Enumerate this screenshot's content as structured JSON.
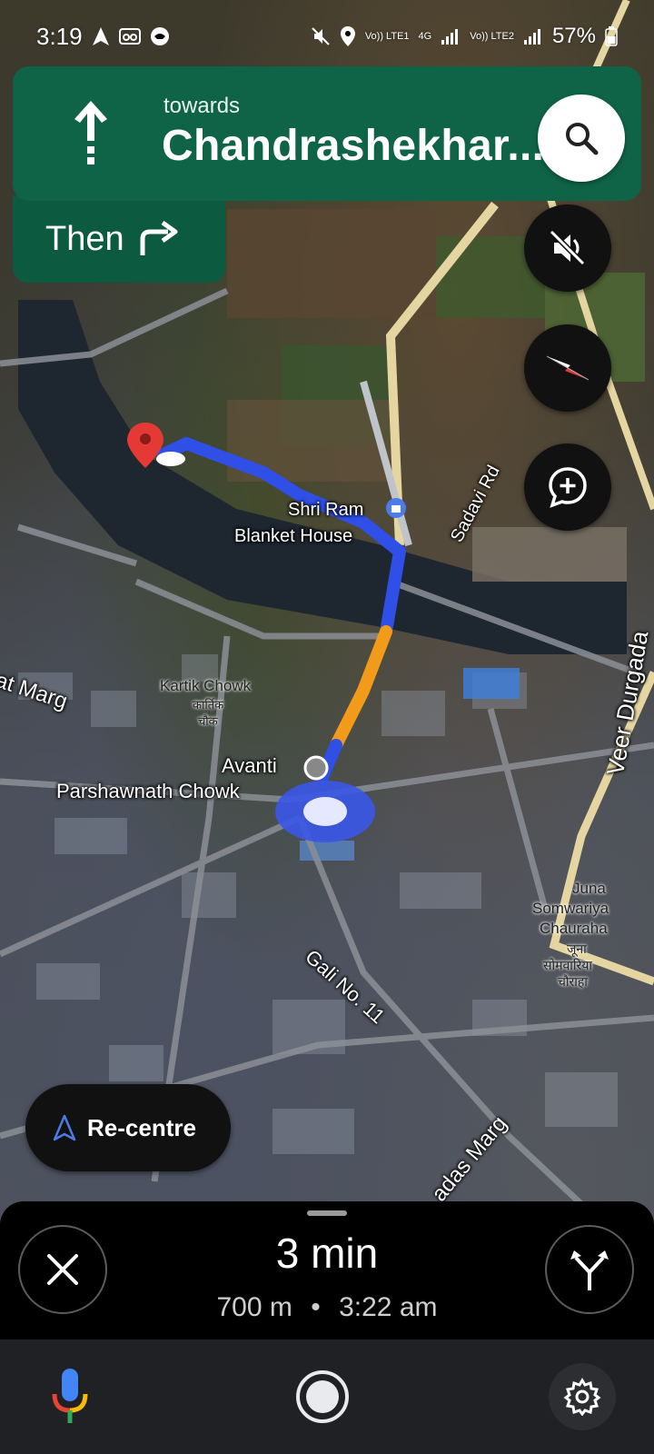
{
  "status_bar": {
    "time": "3:19",
    "sim1": "Vo)) LTE1",
    "network": "4G",
    "sim2": "Vo)) LTE2",
    "battery": "57%"
  },
  "navigation": {
    "towards_label": "towards",
    "street": "Chandrashekhar...",
    "then_label": "Then",
    "direction": "straight",
    "next_direction": "right"
  },
  "map_labels": {
    "poi_shop": "Shri Ram",
    "poi_shop_line2": "Blanket House",
    "road_sadavi": "Sadavi Rd",
    "road_veer": "Veer Durgada",
    "road_marg_left": "at Marg",
    "chowk_kartik": "Kartik Chowk",
    "chowk_kartik_hi": "कार्तिक",
    "chowk_kartik_hi2": "चौक",
    "place_avanti": "Avanti",
    "place_parshawnath": "Parshawnath Chowk",
    "place_juna": "Juna",
    "place_somwariya": "Somwariya",
    "place_chauraha": "Chauraha",
    "place_hi1": "जूना",
    "place_hi2": "सोमवारिया",
    "place_hi3": "चौराहा",
    "road_gali": "Gali No. 11",
    "road_das": "adas Marg"
  },
  "buttons": {
    "recentre_label": "Re-centre"
  },
  "trip": {
    "duration": "3 min",
    "distance": "700 m",
    "separator": "•",
    "eta": "3:22 am"
  },
  "colors": {
    "nav_green": "#0f6447",
    "route_blue": "#2f4fe6",
    "traffic_orange": "#f29a1a",
    "destination_red": "#e53935"
  },
  "icons": {
    "search": "search-icon",
    "mute": "volume-mute-icon",
    "compass": "compass-icon",
    "report": "add-report-icon",
    "recentre": "navigation-arrow-icon",
    "close": "close-icon",
    "alt_routes": "alternate-routes-icon",
    "mic": "microphone-icon",
    "home": "home-circle-icon",
    "settings": "settings-gear-icon"
  }
}
